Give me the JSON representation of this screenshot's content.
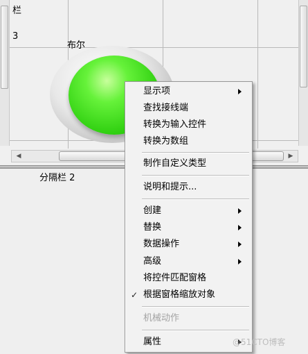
{
  "front_panel": {
    "pane_label_partial": "栏",
    "pane_label_number": "3",
    "bool_label": "布尔",
    "led_state": "on",
    "led_color": "#3fe21a",
    "bottom_pane_label": "分隔栏 2"
  },
  "context_menu": {
    "items": [
      {
        "label": "显示项",
        "submenu": true,
        "checked": false,
        "enabled": true
      },
      {
        "label": "查找接线端",
        "submenu": false,
        "checked": false,
        "enabled": true
      },
      {
        "label": "转换为输入控件",
        "submenu": false,
        "checked": false,
        "enabled": true
      },
      {
        "label": "转换为数组",
        "submenu": false,
        "checked": false,
        "enabled": true
      },
      {
        "label": "制作自定义类型",
        "submenu": false,
        "checked": false,
        "enabled": true
      },
      {
        "label": "说明和提示...",
        "submenu": false,
        "checked": false,
        "enabled": true
      },
      {
        "label": "创建",
        "submenu": true,
        "checked": false,
        "enabled": true
      },
      {
        "label": "替换",
        "submenu": true,
        "checked": false,
        "enabled": true
      },
      {
        "label": "数据操作",
        "submenu": true,
        "checked": false,
        "enabled": true
      },
      {
        "label": "高级",
        "submenu": true,
        "checked": false,
        "enabled": true
      },
      {
        "label": "将控件匹配窗格",
        "submenu": false,
        "checked": false,
        "enabled": true
      },
      {
        "label": "根据窗格缩放对象",
        "submenu": false,
        "checked": true,
        "enabled": true
      },
      {
        "label": "机械动作",
        "submenu": false,
        "checked": false,
        "enabled": false
      },
      {
        "label": "属性",
        "submenu": true,
        "checked": false,
        "enabled": true
      }
    ],
    "check_glyph": "✓"
  },
  "watermark": "@51CTO博客"
}
